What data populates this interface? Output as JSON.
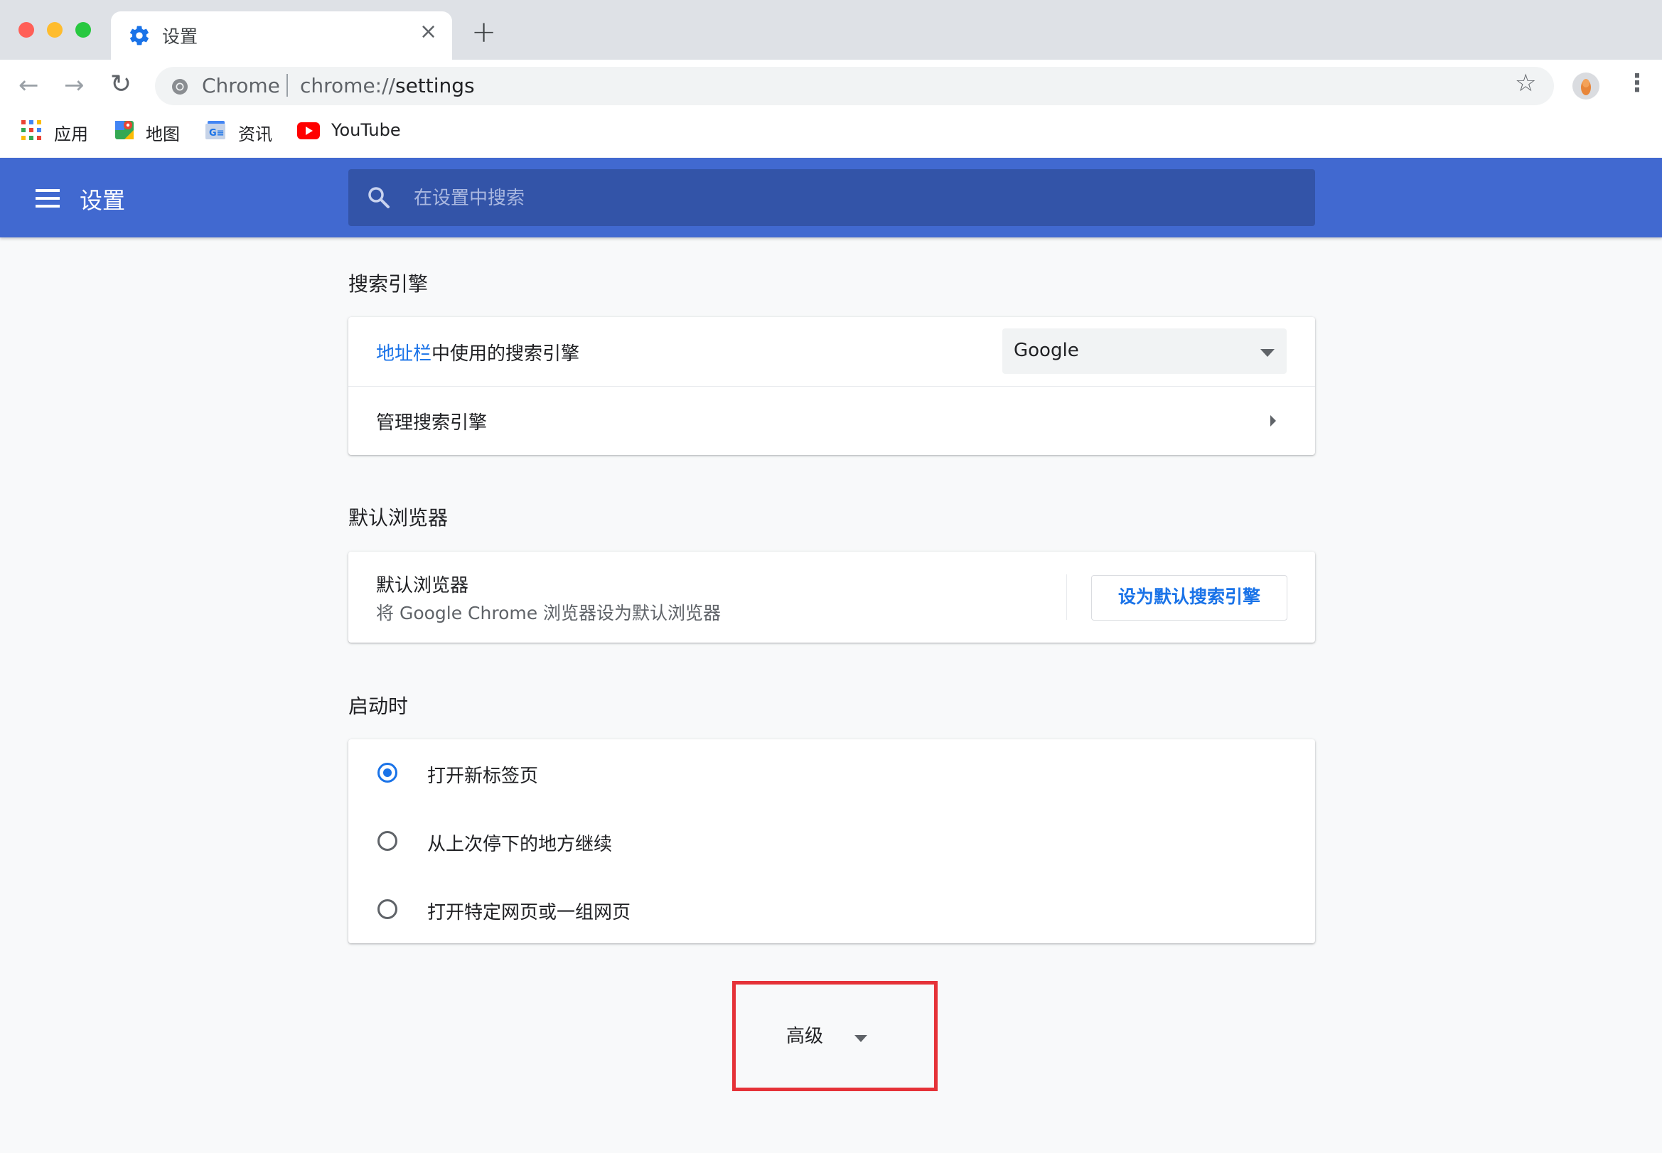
{
  "window": {
    "traffic_lights": [
      "#ff5f57",
      "#febc2e",
      "#28c840"
    ]
  },
  "tab": {
    "title": "设置",
    "close_glyph": "×",
    "new_tab_glyph": "+",
    "icon": "gear-icon"
  },
  "toolbar": {
    "back_glyph": "←",
    "forward_glyph": "→",
    "reload_glyph": "↻",
    "omnibox": {
      "site_label": "Chrome",
      "url_scheme": "chrome://",
      "url_host": "settings"
    },
    "star_glyph": "☆",
    "menu_glyph": "⋮"
  },
  "bookmarks": [
    {
      "label": "应用",
      "icon": "apps-grid-icon"
    },
    {
      "label": "地图",
      "icon": "maps-icon"
    },
    {
      "label": "资讯",
      "icon": "news-icon"
    },
    {
      "label": "YouTube",
      "icon": "youtube-icon"
    }
  ],
  "settings_header": {
    "title": "设置",
    "search_placeholder": "在设置中搜索",
    "accent_color": "#4169d0"
  },
  "sections": {
    "search_engine": {
      "title": "搜索引擎",
      "address_bar_link": "地址栏",
      "address_bar_rest": "中使用的搜索引擎",
      "selected_engine": "Google",
      "manage_label": "管理搜索引擎"
    },
    "default_browser": {
      "title": "默认浏览器",
      "row_title": "默认浏览器",
      "row_subtitle": "将 Google Chrome 浏览器设为默认浏览器",
      "button_label": "设为默认搜索引擎"
    },
    "on_startup": {
      "title": "启动时",
      "options": [
        {
          "label": "打开新标签页",
          "selected": true
        },
        {
          "label": "从上次停下的地方继续",
          "selected": false
        },
        {
          "label": "打开特定网页或一组网页",
          "selected": false
        }
      ]
    }
  },
  "advanced": {
    "label": "高级",
    "highlight_color": "#e53238"
  }
}
